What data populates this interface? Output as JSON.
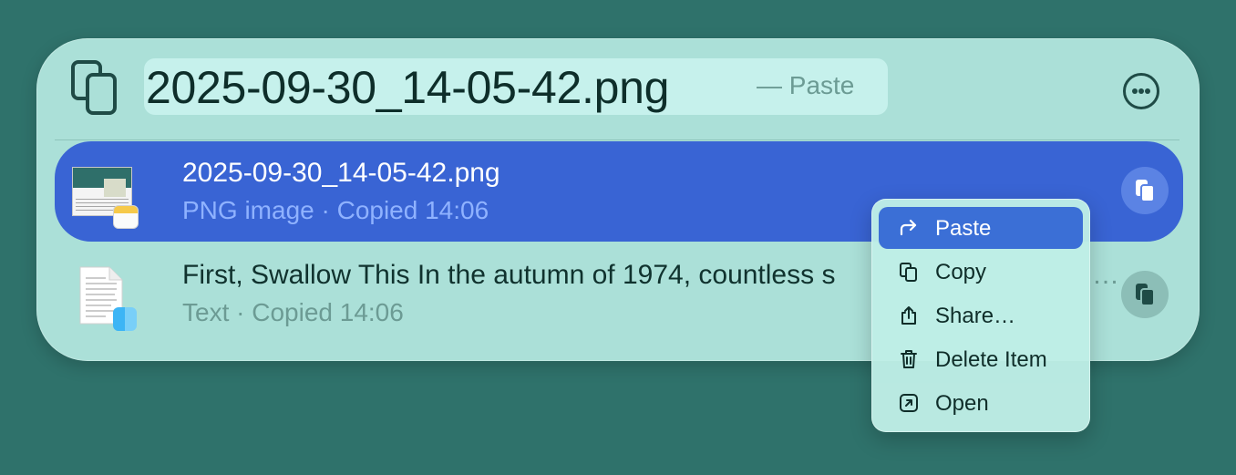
{
  "header": {
    "title": "2025-09-30_14-05-42.png",
    "suffix": "— Paste",
    "header_icon": "clipboard-docs-icon",
    "more_icon": "ellipsis-circle-icon"
  },
  "items": [
    {
      "title": "2025-09-30_14-05-42.png",
      "subtitle": "PNG image · Copied 14:06",
      "icon": "image-thumbnail-icon",
      "badge": "notes-app-icon",
      "selected": true
    },
    {
      "title": "First, Swallow This In the autumn of 1974, countless s",
      "title_tail": "…",
      "subtitle": "Text · Copied 14:06",
      "icon": "text-document-icon",
      "badge": "finder-app-icon",
      "selected": false
    }
  ],
  "context_menu": {
    "items": [
      {
        "label": "Paste",
        "icon": "paste-arrow-icon",
        "active": true
      },
      {
        "label": "Copy",
        "icon": "copy-icon",
        "active": false
      },
      {
        "label": "Share…",
        "icon": "share-icon",
        "active": false
      },
      {
        "label": "Delete Item",
        "icon": "trash-icon",
        "active": false
      },
      {
        "label": "Open",
        "icon": "open-external-icon",
        "active": false
      }
    ]
  },
  "colors": {
    "background": "#2f726b",
    "panel": "#abe0d8",
    "selection": "#3964d4",
    "menu_active": "#3b6fd6"
  }
}
